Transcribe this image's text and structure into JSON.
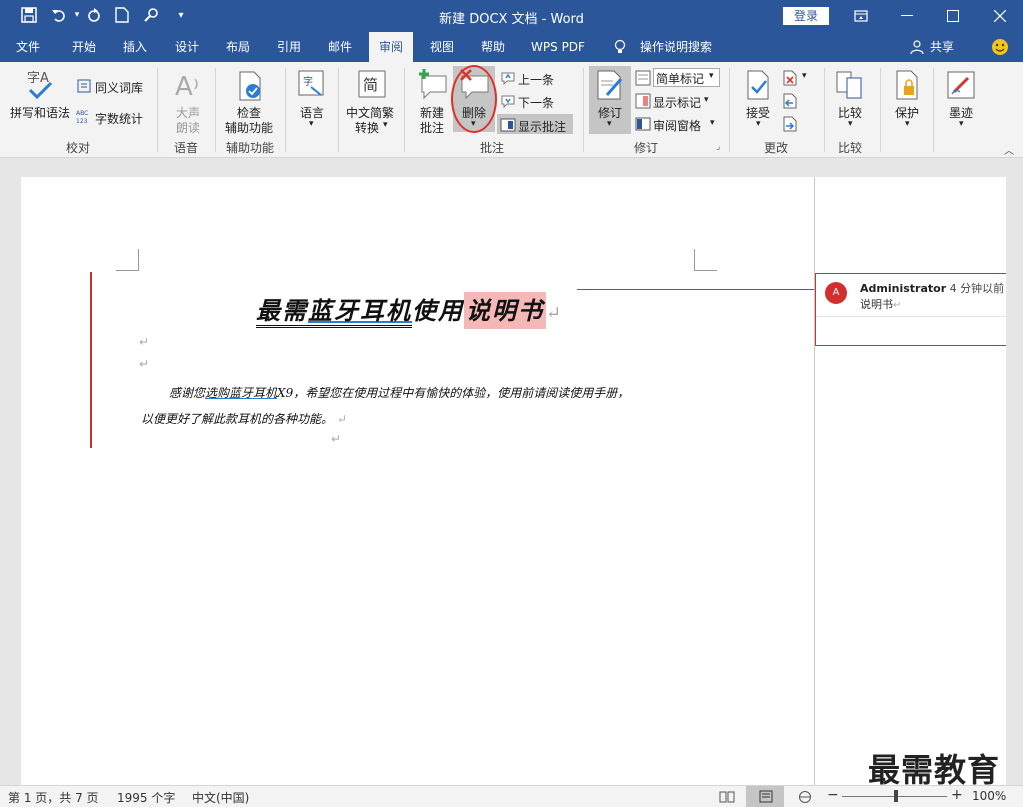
{
  "app": {
    "document_title": "新建 DOCX 文档 - Word",
    "login_label": "登录"
  },
  "tabs": [
    "文件",
    "开始",
    "插入",
    "设计",
    "布局",
    "引用",
    "邮件",
    "审阅",
    "视图",
    "帮助",
    "WPS PDF",
    "操作说明搜索"
  ],
  "active_tab": "审阅",
  "share_label": "共享",
  "ribbon": {
    "proofing": {
      "spelling": "拼写和语法",
      "thesaurus": "同义词库",
      "wordcount": "字数统计",
      "label": "校对"
    },
    "speech": {
      "read_aloud_line1": "大声",
      "read_aloud_line2": "朗读",
      "label": "语音"
    },
    "accessibility": {
      "check_line1": "检查",
      "check_line2": "辅助功能",
      "label": "辅助功能"
    },
    "language": {
      "language": "语言"
    },
    "chinese": {
      "convert_line1": "中文简繁",
      "convert_line2": "转换"
    },
    "comments": {
      "new_line1": "新建",
      "new_line2": "批注",
      "delete": "删除",
      "previous": "上一条",
      "next": "下一条",
      "show": "显示批注",
      "label": "批注"
    },
    "tracking": {
      "track": "修订",
      "simple_markup": "简单标记",
      "show_markup": "显示标记",
      "review_pane": "审阅窗格",
      "label": "修订"
    },
    "changes": {
      "accept": "接受",
      "label": "更改"
    },
    "compare": {
      "compare": "比较",
      "label": "比较"
    },
    "protect": {
      "protect": "保护"
    },
    "ink": {
      "ink": "墨迹"
    }
  },
  "document": {
    "title_part1": "最需",
    "title_part2": "蓝牙耳机",
    "title_part3": "使用",
    "title_highlight": "说明书",
    "body_prefix": "感谢您",
    "body_underlined": "选购蓝牙耳机",
    "body_rest": "X9，希望您在使用过程中有愉快的体验，使用前请阅读使用手册，",
    "body_line2": "以便更好了解此款耳机的各种功能。"
  },
  "comment": {
    "avatar_letter": "A",
    "author": "Administrator",
    "time": "4 分钟以前",
    "text": "说明书"
  },
  "status": {
    "page": "第 1 页，共 7 页",
    "words": "1995 个字",
    "language": "中文(中国)",
    "zoom": "100%"
  },
  "watermark": "最需教育",
  "colors": {
    "accent": "#2b579a",
    "comment_red": "#c0392b",
    "highlight": "#f4b8b8",
    "annotation_circle": "#e0302b"
  }
}
